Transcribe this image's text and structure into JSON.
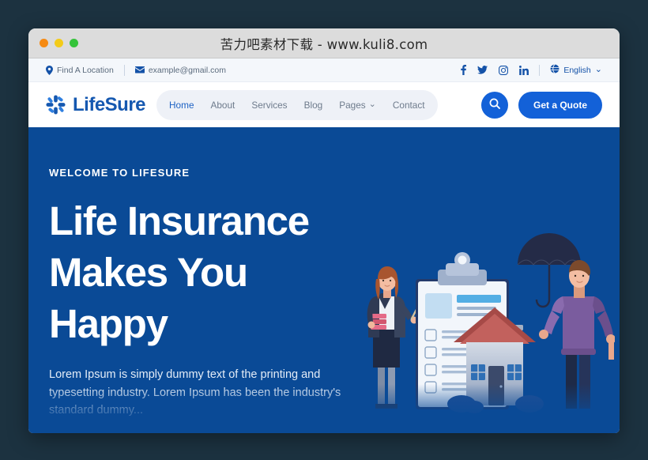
{
  "window": {
    "title": "苦力吧素材下载 - www.kuli8.com",
    "traffic_lights": [
      "close",
      "minimize",
      "maximize"
    ]
  },
  "topbar": {
    "location": {
      "label": "Find A Location",
      "icon": "map-pin-icon"
    },
    "email": {
      "label": "example@gmail.com",
      "icon": "envelope-icon"
    },
    "socials": [
      {
        "name": "facebook-icon",
        "label": "f"
      },
      {
        "name": "twitter-icon",
        "label": ""
      },
      {
        "name": "instagram-icon",
        "label": ""
      },
      {
        "name": "linkedin-icon",
        "label": "in"
      }
    ],
    "language": {
      "label": "English",
      "icon": "globe-icon",
      "caret": "⌄"
    }
  },
  "header": {
    "brand": {
      "name": "LifeSure",
      "icon": "pinwheel-logo-icon"
    },
    "nav": [
      {
        "label": "Home",
        "active": true,
        "caret": ""
      },
      {
        "label": "About",
        "active": false,
        "caret": ""
      },
      {
        "label": "Services",
        "active": false,
        "caret": ""
      },
      {
        "label": "Blog",
        "active": false,
        "caret": ""
      },
      {
        "label": "Pages",
        "active": false,
        "caret": "⌄"
      },
      {
        "label": "Contact",
        "active": false,
        "caret": ""
      }
    ],
    "search": {
      "icon": "search-icon",
      "label": ""
    },
    "cta": {
      "label": "Get a Quote"
    }
  },
  "hero": {
    "eyebrow": "WELCOME TO LIFESURE",
    "title_line1": "Life Insurance",
    "title_line2": "Makes You",
    "title_line3": "Happy",
    "paragraph": "Lorem Ipsum is simply dummy text of the printing and typesetting industry. Lorem Ipsum has been the industry's standard dummy...",
    "illustration": "insurance-clipboard-house-umbrella-illustration"
  },
  "colors": {
    "page_background": "#1c3240",
    "titlebar": "#dcdcdc",
    "topbar": "#f4f7fb",
    "brand_blue": "#1558b0",
    "accent_blue": "#1361d8",
    "hero_blue": "#0a4a96",
    "nav_pill": "#eef1f7",
    "light_red": "#f68a12",
    "light_amber": "#f3cb19",
    "light_green": "#35c33a"
  }
}
